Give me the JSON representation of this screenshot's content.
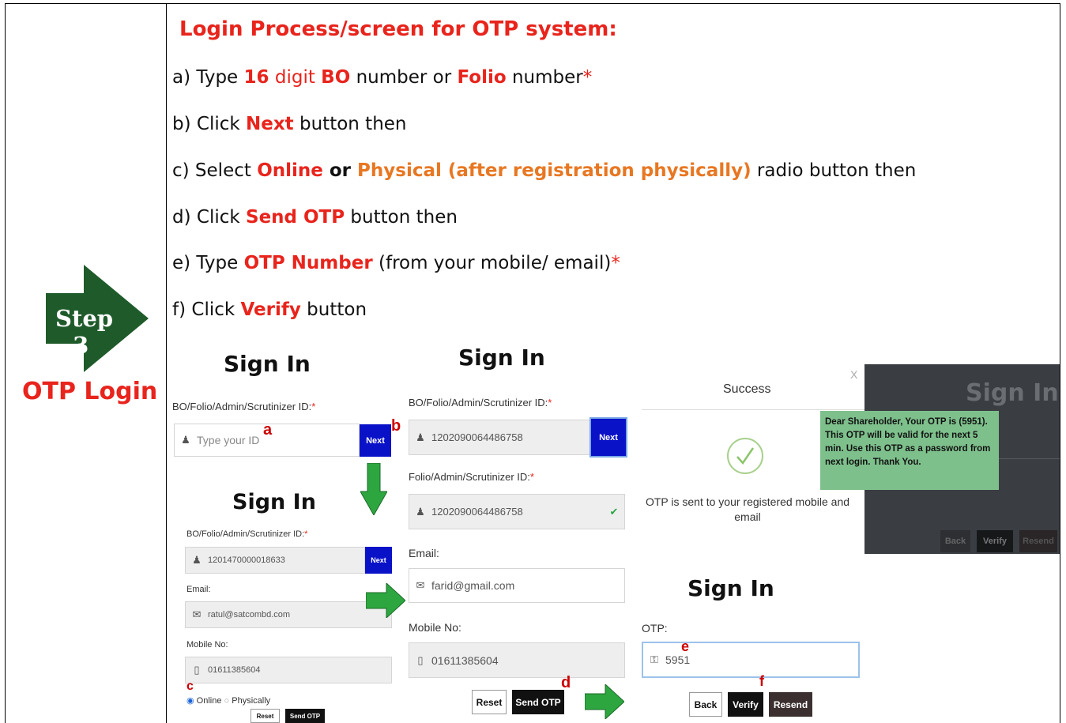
{
  "step": {
    "label": "Step - 3",
    "sublabel": "OTP Login"
  },
  "title": "Login Process/screen for OTP system:",
  "instructions": {
    "a": {
      "p1": "a) Type ",
      "n16": "16",
      "digit": " digit ",
      "bo": "BO",
      "p2": " number or ",
      "folio": "Folio",
      "p3": " number",
      "star": "*"
    },
    "b": {
      "p1": "b) Click ",
      "next": "Next",
      "p2": " button then"
    },
    "c": {
      "p1": "c) Select ",
      "online": "Online",
      "or": " or ",
      "physical": "Physical (after registration physically)",
      "p2": " radio button then"
    },
    "d": {
      "p1": "d) Click ",
      "send": "Send OTP",
      "p2": " button then"
    },
    "e": {
      "p1": "e) Type ",
      "otp": "OTP Number",
      "p2": " (from your mobile/ email)",
      "star": "*"
    },
    "f": {
      "p1": "f)  Click ",
      "verify": "Verify",
      "p2": " button"
    }
  },
  "screen1": {
    "title": "Sign In",
    "id_label": "BO/Folio/Admin/Scrutinizer ID:",
    "id_star": "*",
    "placeholder": "Type your ID",
    "next": "Next",
    "marker_a": "a",
    "marker_b": "b"
  },
  "screen2": {
    "title": "Sign In",
    "id_label": "BO/Folio/Admin/Scrutinizer ID:",
    "id_star": "*",
    "id_value": "1201470000018633",
    "next": "Next",
    "email_label": "Email:",
    "email_value": "ratul@satcombd.com",
    "mobile_label": "Mobile No:",
    "mobile_value": "01611385604",
    "online": "Online",
    "physically": "Physically",
    "reset": "Reset",
    "send_otp": "Send OTP",
    "marker_c": "c"
  },
  "screen3": {
    "title": "Sign In",
    "id_label": "BO/Folio/Admin/Scrutinizer ID:",
    "id_star": "*",
    "id_value": "1202090064486758",
    "next": "Next",
    "folio_label": "Folio/Admin/Scrutinizer ID:",
    "folio_star": "*",
    "folio_value": "1202090064486758",
    "email_label": "Email:",
    "email_value": "farid@gmail.com",
    "mobile_label": "Mobile No:",
    "mobile_value": "01611385604",
    "reset": "Reset",
    "send_otp": "Send OTP",
    "marker_d": "d"
  },
  "success": {
    "title": "Success",
    "close": "X",
    "message": "OTP is sent to your registered mobile and email",
    "tooltip": "Dear Shareholder, Your OTP is (5951). This OTP will be valid for the next 5 min. Use this OTP as a password from next login. Thank You.",
    "bg_title": "Sign In",
    "bg_back": "Back",
    "bg_verify": "Verify",
    "bg_resend": "Resend"
  },
  "screen4": {
    "title": "Sign In",
    "otp_label": "OTP:",
    "otp_value": "5951",
    "back": "Back",
    "verify": "Verify",
    "resend": "Resend",
    "marker_e": "e",
    "marker_f": "f"
  },
  "colors": {
    "red": "#e8241c",
    "orange": "#e87722",
    "step_green": "#1f5b2a",
    "arrow_green": "#2ea640",
    "next_blue": "#0a12c8",
    "tooltip_green": "#7ec08c"
  }
}
